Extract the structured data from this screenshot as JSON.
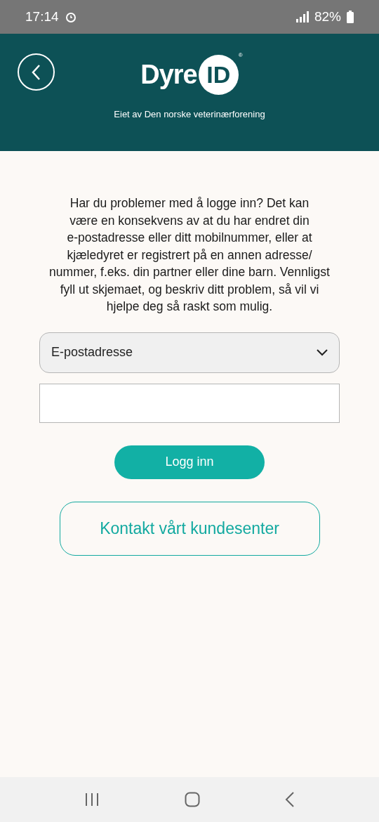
{
  "status_bar": {
    "time": "17:14",
    "battery": "82%"
  },
  "header": {
    "logo_word": "Dyre",
    "logo_badge": "ID",
    "logo_mark": "®",
    "subtitle": "Eiet av Den norske veterinærforening"
  },
  "intro": "Har du problemer med å logge inn? Det kan\nvære en konsekvens av at du har endret din\ne-postadresse eller ditt mobilnummer, eller at\nkjæledyret er registrert på en annen adresse/\nnummer, f.eks. din partner eller dine barn. Vennligst\nfyll ut skjemaet, og beskriv ditt problem, så vil vi\nhjelpe deg så raskt som mulig.",
  "login_method": {
    "value": "E-postadresse"
  },
  "buttons": [
    {
      "kind": "filled",
      "label": "Logg inn"
    },
    {
      "kind": "outline",
      "label": "Kontakt vårt kundesenter"
    }
  ]
}
